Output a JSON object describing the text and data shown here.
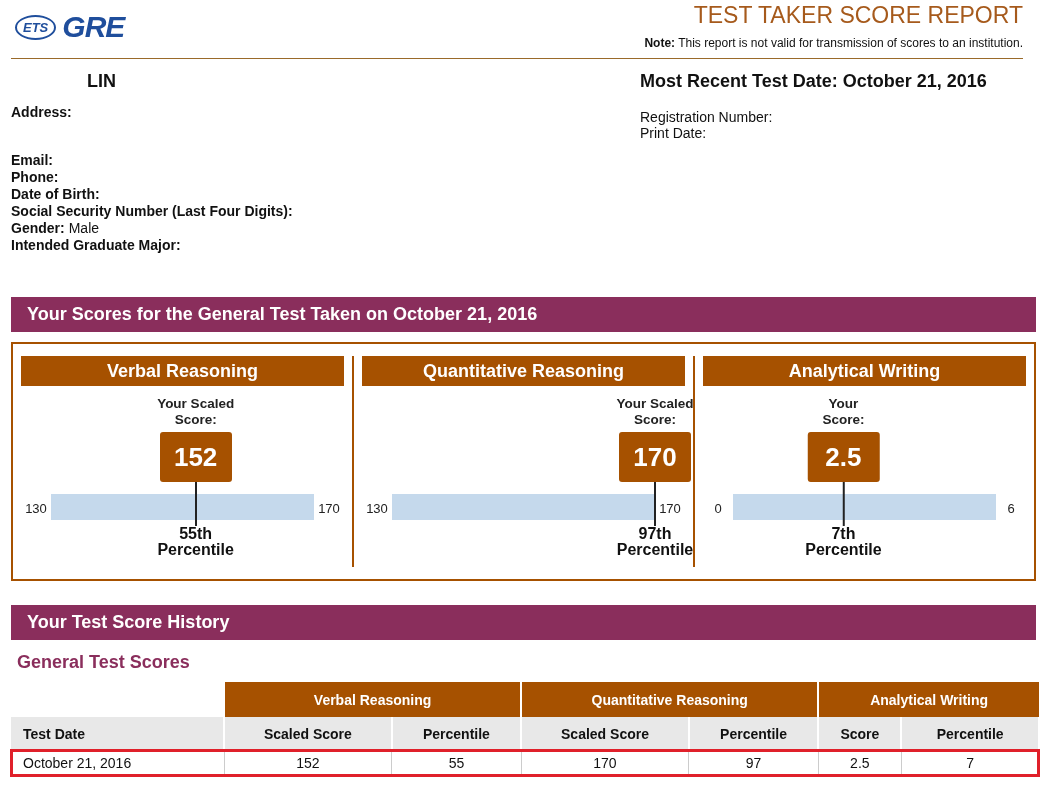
{
  "header": {
    "logo_ets": "ETS",
    "logo_gre": "GRE",
    "title": "TEST TAKER SCORE REPORT",
    "note_label": "Note:",
    "note": "This report is not valid for transmission of scores to an institution."
  },
  "candidate": {
    "name": "LIN",
    "test_date": "Most Recent Test Date: October 21, 2016"
  },
  "left_fields": [
    {
      "label": "Email:"
    },
    {
      "label": "Phone:"
    },
    {
      "label": "Date of Birth:"
    },
    {
      "label": "Social Security Number (Last Four Digits):"
    },
    {
      "label": "Gender:",
      "value": "Male"
    },
    {
      "label": "Intended Graduate Major:"
    }
  ],
  "address_label": "Address:",
  "right_fields": [
    "Registration Number:",
    "Print Date:"
  ],
  "scores_banner": "Your Scores for the General Test Taken on October 21, 2016",
  "scores": [
    {
      "title": "Verbal Reasoning",
      "prompt": "Your Scaled Score:",
      "score": "152",
      "min": "130",
      "max": "170",
      "level": 0.55,
      "percentile": "55th",
      "percentile_label": "Percentile"
    },
    {
      "title": "Quantitative Reasoning",
      "prompt": "Your Scaled Score:",
      "score": "170",
      "min": "130",
      "max": "170",
      "level": 1.0,
      "percentile": "97th",
      "percentile_label": "Percentile"
    },
    {
      "title": "Analytical Writing",
      "prompt": "Your Score:",
      "score": "2.5",
      "min": "0",
      "max": "6",
      "level": 0.42,
      "percentile": "7th",
      "percentile_label": "Percentile"
    }
  ],
  "history_banner": "Your Test Score History",
  "history_subtitle": "General Test Scores",
  "table": {
    "groups": [
      "Verbal Reasoning",
      "Quantitative Reasoning",
      "Analytical Writing"
    ],
    "columns": [
      "Test Date",
      "Scaled Score",
      "Percentile",
      "Scaled Score",
      "Percentile",
      "Score",
      "Percentile"
    ],
    "rows": [
      {
        "cells": [
          "October 21, 2016",
          "152",
          "55",
          "170",
          "97",
          "2.5",
          "7"
        ],
        "highlighted": true
      }
    ]
  }
}
